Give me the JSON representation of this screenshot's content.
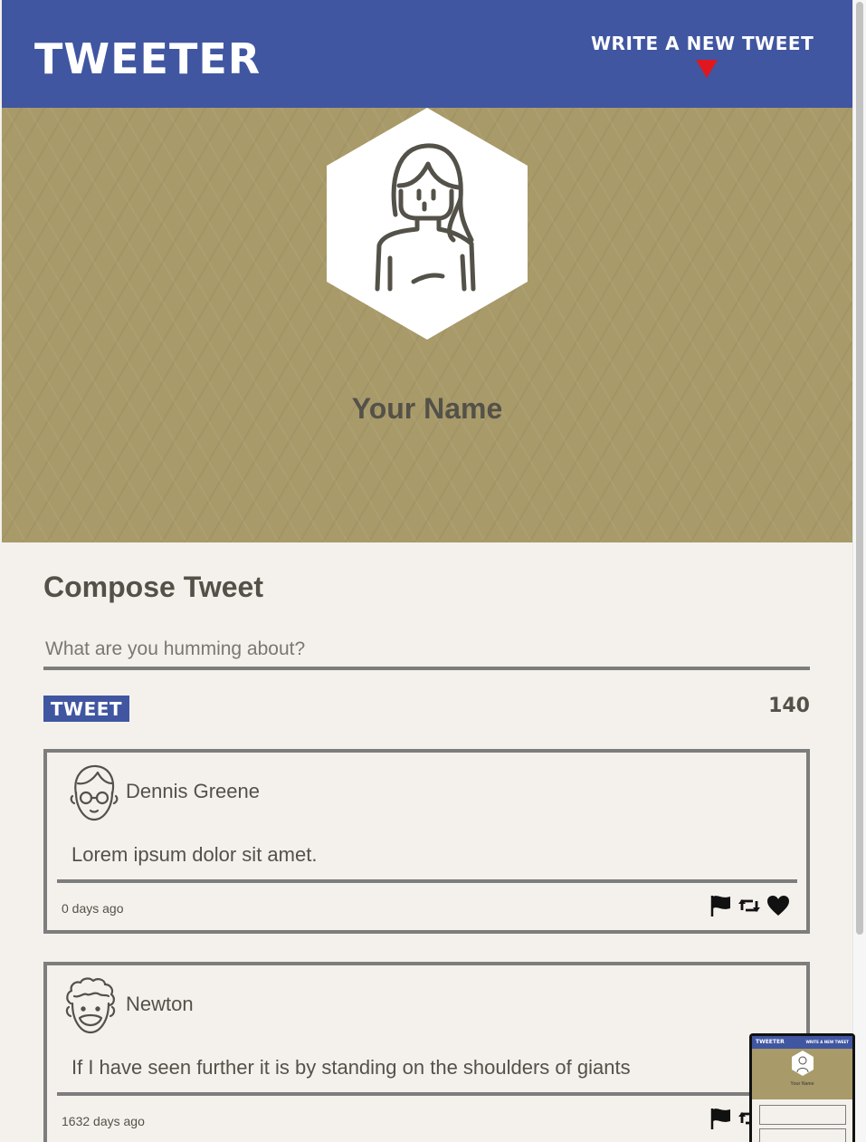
{
  "nav": {
    "brand": "TWEETER",
    "compose_link": "WRITE A NEW TWEET"
  },
  "profile": {
    "name": "Your Name"
  },
  "compose": {
    "title": "Compose Tweet",
    "placeholder": "What are you humming about?",
    "button_label": "TWEET",
    "counter": "140"
  },
  "tweets": [
    {
      "author": "Dennis Greene",
      "text": "Lorem ipsum dolor sit amet.",
      "time": "0 days ago",
      "avatar_icon": "person-with-glasses-icon"
    },
    {
      "author": "Newton",
      "text": "If I have seen further it is by standing on the shoulders of giants",
      "time": "1632 days ago",
      "avatar_icon": "curly-hair-person-icon"
    }
  ],
  "minimap": {
    "brand": "TWEETER",
    "compose_link": "WRITE A NEW TWEET",
    "name": "Your Name"
  },
  "colors": {
    "nav": "#4056a1",
    "profile_bg": "#a89a69",
    "page_bg": "#f4f1ec",
    "text": "#545149",
    "border": "#7d7d7d",
    "accent_arrow": "#e0171f"
  }
}
